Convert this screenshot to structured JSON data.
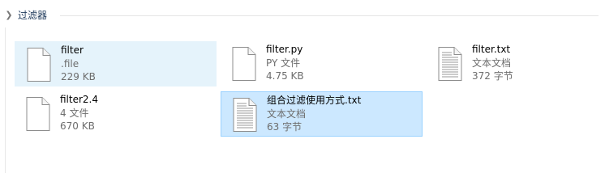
{
  "group": {
    "title": "过滤器",
    "icon": "chevron-right-icon"
  },
  "files": [
    {
      "name": "filter",
      "type": ".file",
      "size": "229 KB",
      "icon": "blank-file-icon",
      "state": "hover"
    },
    {
      "name": "filter.py",
      "type": "PY 文件",
      "size": "4.75 KB",
      "icon": "blank-file-icon",
      "state": "normal"
    },
    {
      "name": "filter.txt",
      "type": "文本文档",
      "size": "372 字节",
      "icon": "text-document-icon",
      "state": "normal"
    },
    {
      "name": "filter2.4",
      "type": "4 文件",
      "size": "670 KB",
      "icon": "blank-file-icon",
      "state": "normal"
    },
    {
      "name": "组合过滤使用方式.txt",
      "type": "文本文档",
      "size": "63 字节",
      "icon": "text-document-icon",
      "state": "selected"
    }
  ],
  "colors": {
    "hover_bg": "#e5f3fb",
    "selected_bg": "#cce8ff",
    "selected_border": "#99d1ff"
  }
}
